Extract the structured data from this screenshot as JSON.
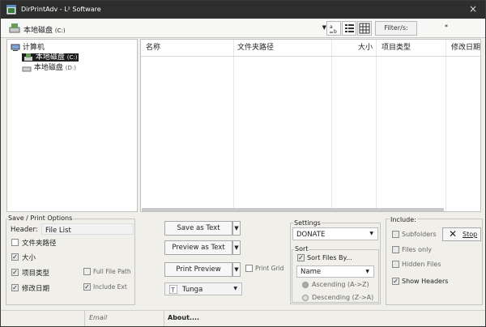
{
  "window": {
    "title": "DirPrintAdv - L² Software"
  },
  "toolbar": {
    "drive_label": "本地磁盘",
    "drive_sub": "(C:)",
    "filter_label": "Filter/s:",
    "filter_value": "*"
  },
  "tree": {
    "root": "计算机",
    "items": [
      {
        "label": "本地磁盘",
        "sub": "(C:)"
      },
      {
        "label": "本地磁盘",
        "sub": "(D:)"
      }
    ]
  },
  "list": {
    "columns": [
      "名称",
      "文件夹路径",
      "大小",
      "项目类型",
      "修改日期"
    ]
  },
  "options": {
    "group_label": "Save / Print Options",
    "header_label": "Header:",
    "header_value": "File List",
    "cols": [
      {
        "label": "文件夹路径",
        "checked": false
      },
      {
        "label": "大小",
        "checked": true
      },
      {
        "label": "项目类型",
        "checked": true
      },
      {
        "label": "修改日期",
        "checked": true
      }
    ],
    "full_file_path": "Full File Path",
    "include_ext": "Include Ext"
  },
  "actions": {
    "save_text": "Save as Text",
    "preview_text": "Preview as Text",
    "print_preview": "Print Preview",
    "print_grid": "Print Grid",
    "font": "Tunga"
  },
  "settings": {
    "label": "Settings",
    "value": "DONATE",
    "sort_label": "Sort",
    "sort_files_by": "Sort Files By...",
    "sort_field": "Name",
    "ascending": "Ascending (A->Z)",
    "descending": "Descending (Z->A)"
  },
  "include": {
    "label": "Include:",
    "subfolders": "Subfolders",
    "files_only": "Files only",
    "hidden_files": "Hidden Files",
    "show_headers": "Show Headers",
    "stop": "Stop"
  },
  "status": {
    "email": "Email",
    "about": "About...."
  }
}
